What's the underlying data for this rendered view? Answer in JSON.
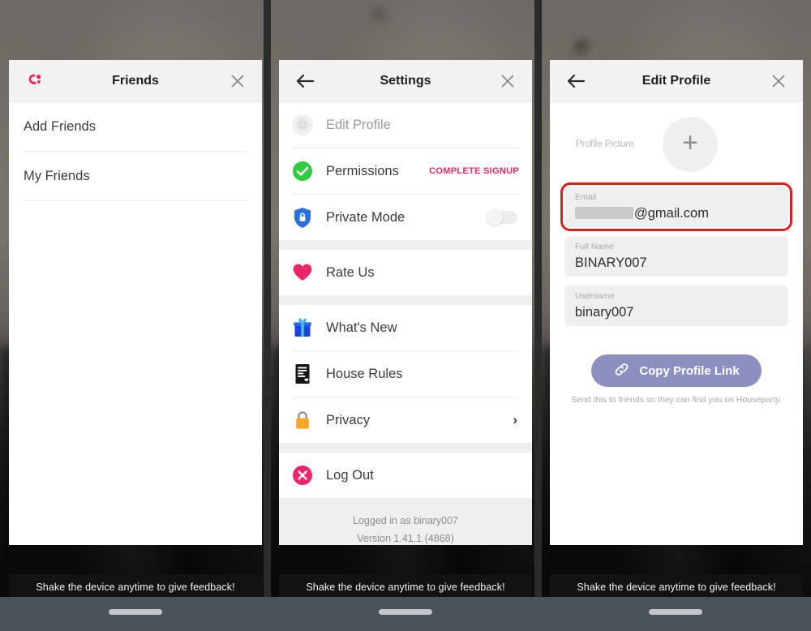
{
  "background": {
    "toast_text": "Shake the device anytime to give feedback!"
  },
  "panels": {
    "friends": {
      "logo_icon": "houseparty-logo-icon",
      "title": "Friends",
      "close_icon": "close-icon",
      "items": [
        {
          "label": "Add Friends"
        },
        {
          "label": "My Friends"
        }
      ]
    },
    "settings": {
      "back_icon": "back-arrow-icon",
      "title": "Settings",
      "close_icon": "close-icon",
      "rows": [
        {
          "label": "Edit Profile",
          "icon": "avatar-placeholder-icon",
          "badge": "",
          "accessory": "none"
        },
        {
          "label": "Permissions",
          "icon": "green-check-icon",
          "badge": "COMPLETE SIGNUP",
          "accessory": "badge"
        },
        {
          "label": "Private Mode",
          "icon": "blue-shield-lock-icon",
          "badge": "",
          "accessory": "toggle"
        },
        {
          "label": "Rate Us",
          "icon": "heart-icon",
          "badge": "",
          "accessory": "none"
        },
        {
          "label": "What's New",
          "icon": "gift-icon",
          "badge": "",
          "accessory": "none"
        },
        {
          "label": "House Rules",
          "icon": "document-icon",
          "badge": "",
          "accessory": "none"
        },
        {
          "label": "Privacy",
          "icon": "padlock-icon",
          "badge": "",
          "accessory": "chevron"
        },
        {
          "label": "Log Out",
          "icon": "close-circle-icon",
          "badge": "",
          "accessory": "none"
        }
      ],
      "footer": {
        "logged_in_as": "Logged in as binary007",
        "version": "Version 1.41.1 (4868)"
      },
      "toggle_state": "off",
      "chevron_glyph": "›"
    },
    "edit_profile": {
      "back_icon": "back-arrow-icon",
      "title": "Edit Profile",
      "close_icon": "close-icon",
      "profile_picture_label": "Profile Picture",
      "add_photo_glyph": "+",
      "fields": [
        {
          "label": "Email",
          "value": "@gmail.com",
          "redacted": true,
          "highlighted": true
        },
        {
          "label": "Full Name",
          "value": "BINARY007",
          "redacted": false,
          "highlighted": false
        },
        {
          "label": "Username",
          "value": "binary007",
          "redacted": false,
          "highlighted": false
        }
      ],
      "cta": {
        "label": "Copy Profile Link",
        "icon": "link-chain-icon"
      },
      "note": "Send this to friends so they can find you on Houseparty."
    }
  },
  "colors": {
    "brand_pink": "#f0246a",
    "highlight_red": "#e01d1d",
    "cta_purple": "#8b90c0",
    "green": "#2ecc40",
    "shield_blue": "#2d6fe0",
    "lock_orange": "#f5a623",
    "nav_bar": "#4a535a"
  }
}
